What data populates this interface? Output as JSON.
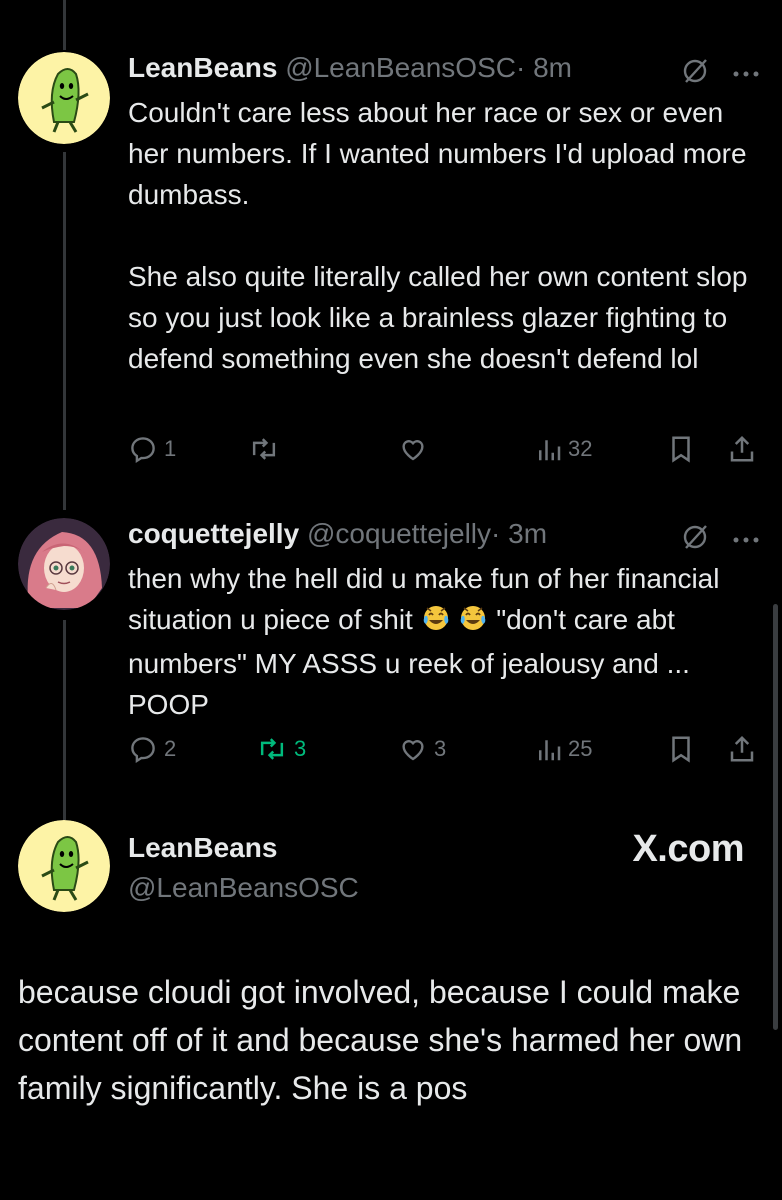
{
  "reply1": {
    "name": "LeanBeans",
    "handle": "@LeanBeansOSC",
    "time": "· 8m",
    "paragraph1": "Couldn't care less about her race or sex or even her numbers. If I wanted numbers I'd upload more dumbass.",
    "paragraph2": "She also quite literally called her own content slop so you just look like a brainless glazer fighting to defend something even she doesn't defend lol",
    "replies": "1",
    "reposts": "",
    "likes": "",
    "views": "32"
  },
  "reply2": {
    "name": "coquettejelly",
    "handle": "@coquettejelly",
    "time": "· 3m",
    "text_part1": "then why the hell did u make fun of her financial situation u piece of shit",
    "text_part2": "\"don't care abt numbers\" MY ASSS u reek of jealousy and ... POOP",
    "replies": "2",
    "reposts": "3",
    "likes": "3",
    "views": "25"
  },
  "main": {
    "name": "LeanBeans",
    "handle": "@LeanBeansOSC",
    "brand": "X.com",
    "text": "because cloudi got involved, because I could make content off of it and because she's harmed her own family significantly. She is a pos"
  },
  "icons": [
    "muted-icon",
    "more-icon",
    "reply-icon",
    "repost-icon",
    "like-icon",
    "views-icon",
    "bookmark-icon",
    "share-icon",
    "crying-laughing-emoji"
  ],
  "colors": {
    "background": "#000000",
    "text": "#e7e9ea",
    "secondary": "#71767b",
    "repost_active": "#00ba7c",
    "avatar_yellow": "#fdf3a6",
    "bean_green": "#7cc644"
  }
}
